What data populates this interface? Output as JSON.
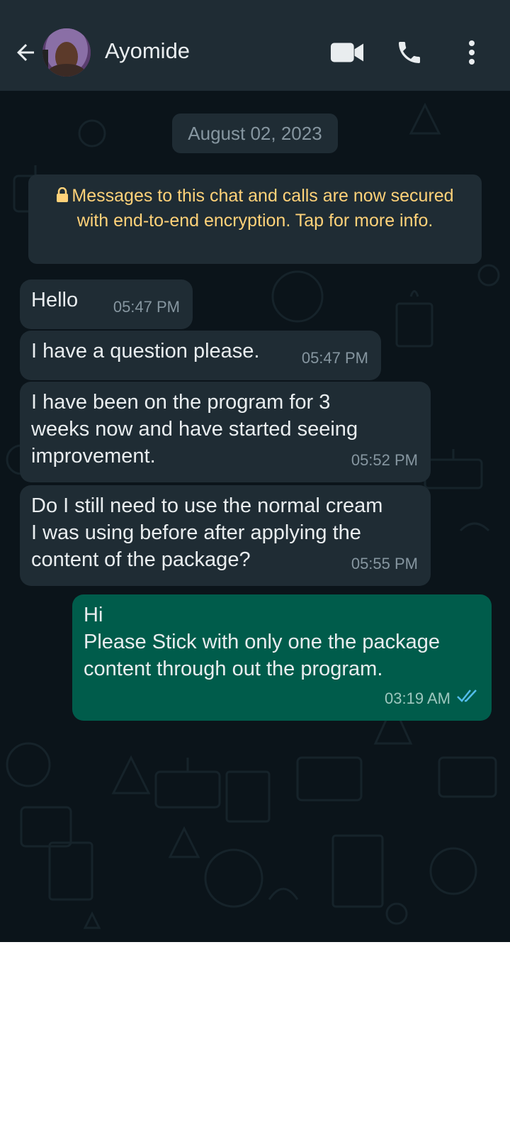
{
  "header": {
    "contact_name": "Ayomide"
  },
  "chat": {
    "date_label": "August 02, 2023",
    "encryption_notice": "Messages to this chat and calls are now secured with end-to-end encryption. Tap for more info.",
    "messages": [
      {
        "direction": "incoming",
        "text": "Hello",
        "time": "05:47 PM"
      },
      {
        "direction": "incoming",
        "text": "I have a question please.",
        "time": "05:47 PM"
      },
      {
        "direction": "incoming",
        "text": "I have been on the program for 3\nweeks now and have started seeing\nimprovement.",
        "time": "05:52 PM"
      },
      {
        "direction": "incoming",
        "text": "Do I still need to use the normal cream\nI was using before after applying the\ncontent of the package?",
        "time": "05:55 PM"
      },
      {
        "direction": "outgoing",
        "text": "Hi\nPlease Stick with only one the package\ncontent through out the program.",
        "time": "03:19 AM",
        "status": "read"
      }
    ]
  },
  "colors": {
    "header_bg": "#1f2c34",
    "chat_bg": "#0b141a",
    "incoming_bubble": "#1f2c34",
    "outgoing_bubble": "#005c4b",
    "notice_text": "#ffd279",
    "read_ticks": "#53bdeb"
  }
}
